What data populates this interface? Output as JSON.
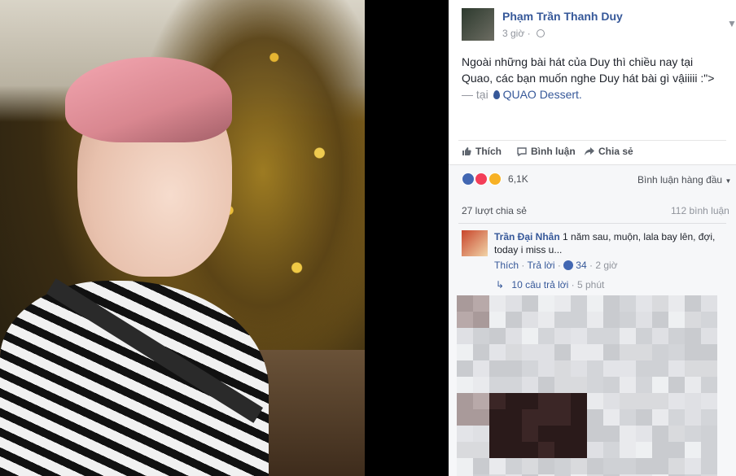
{
  "post": {
    "author": "Phạm Trần Thanh Duy",
    "time": "3 giờ",
    "dot": "·",
    "text": "Ngoài những bài hát của Duy thì chiều nay tại Quao, các bạn muốn nghe Duy hát bài gì vậiiiii :\">",
    "location_prefix": "— tại",
    "location": "QUAO Dessert."
  },
  "actions": {
    "like": "Thích",
    "comment": "Bình luận",
    "share": "Chia sẻ"
  },
  "stats": {
    "reactions": "6,1K",
    "sort": "Bình luận hàng đầu",
    "shares": "27 lượt chia sẻ",
    "comments": "112 bình luận"
  },
  "comment": {
    "name": "Trần Đại Nhân",
    "text": "1 năm sau, muộn, lala bay lên, đợi, today i miss u...",
    "like": "Thích",
    "reply": "Trả lời",
    "likes": "34",
    "time": "2 giờ",
    "replies_label": "10 câu trả lời",
    "replies_time": "5 phút"
  },
  "colors": {
    "link": "#365899",
    "like_blue": "#4267b2",
    "love_red": "#f33e58",
    "haha_yellow": "#f7b125"
  },
  "icons": [
    "thumbs-up-icon",
    "comment-icon",
    "share-arrow-icon",
    "globe-icon",
    "location-pin-icon",
    "chevron-down-icon",
    "reply-arrow-icon"
  ]
}
